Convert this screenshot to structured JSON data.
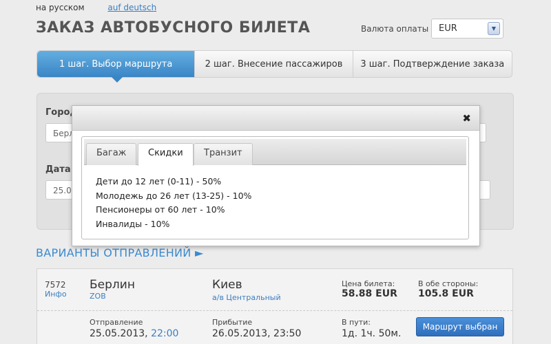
{
  "lang": {
    "current": "на русском",
    "other": "auf deutsch"
  },
  "title": "ЗАКАЗ АВТОБУСНОГО БИЛЕТА",
  "currency": {
    "label": "Валюта оплаты",
    "value": "EUR"
  },
  "steps": [
    {
      "label": "1 шаг. Выбор маршрута"
    },
    {
      "label": "2 шаг. Внесение пассажиров"
    },
    {
      "label": "3 шаг. Подтверждение заказа"
    }
  ],
  "form": {
    "city_label": "Город",
    "city_value": "Берл",
    "date_label": "Дата",
    "date_value": "25.05"
  },
  "section_title": "ВАРИАНТЫ ОТПРАВЛЕНИЙ ►",
  "trip": {
    "number": "7572",
    "info_link": "Инфо",
    "from_city": "Берлин",
    "from_station": "ZOB",
    "to_city": "Киев",
    "to_station": "а/в Центральный",
    "price_label": "Цена билета:",
    "price_value": "58.88 EUR",
    "roundtrip_label": "В обе стороны:",
    "roundtrip_value": "105.8 EUR",
    "departure_label": "Отправление",
    "departure_date": "25.05.2013,",
    "departure_time": "22:00",
    "arrival_label": "Прибытие",
    "arrival_value": "26.05.2013, 23:50",
    "duration_label": "В пути:",
    "duration_value": "1д. 1ч. 50м.",
    "select_button": "Маршрут выбран"
  },
  "dialog": {
    "close": "✖",
    "tabs": [
      "Багаж",
      "Скидки",
      "Транзит"
    ],
    "active_tab": "Скидки",
    "discounts": [
      "Дети до 12 лет (0-11) - 50%",
      "Молодежь до 26 лет (13-25) - 10%",
      "Пенсионеры от 60 лет - 10%",
      "Инвалиды - 10%"
    ]
  }
}
